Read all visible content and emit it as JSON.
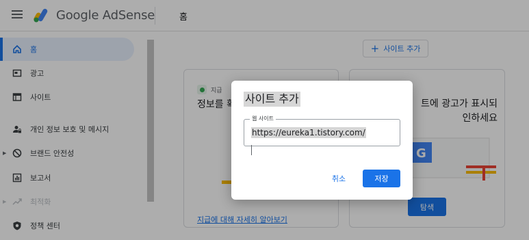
{
  "header": {
    "app_name": "Google AdSense",
    "page_title": "홈"
  },
  "sidebar": {
    "items": [
      {
        "label": "홈",
        "icon": "home-icon",
        "active": true
      },
      {
        "label": "광고",
        "icon": "ads-icon"
      },
      {
        "label": "사이트",
        "icon": "sites-icon"
      },
      {
        "label": "개인 정보 보호 및 메시지",
        "icon": "privacy-icon"
      },
      {
        "label": "브랜드 안전성",
        "icon": "block-icon"
      },
      {
        "label": "보고서",
        "icon": "report-icon"
      },
      {
        "label": "최적화",
        "icon": "trending-icon",
        "disabled": true
      },
      {
        "label": "정책 센터",
        "icon": "policy-icon"
      }
    ]
  },
  "main": {
    "add_site_label": "사이트 추가",
    "card1": {
      "status": "지급",
      "title": "정보를 확",
      "link": "지급에 대해 자세히 알아보기"
    },
    "card2": {
      "title": "트에 광고가 표시되\n인하세요",
      "button": "탐색"
    }
  },
  "dialog": {
    "title": "사이트 추가",
    "field_label": "웹 사이트",
    "field_value": "https://eureka1.tistory.com/",
    "cancel_label": "취소",
    "save_label": "저장"
  },
  "colors": {
    "accent": "#1a73e8",
    "active_bg": "#e8f0fe",
    "status_green": "#34a853"
  }
}
